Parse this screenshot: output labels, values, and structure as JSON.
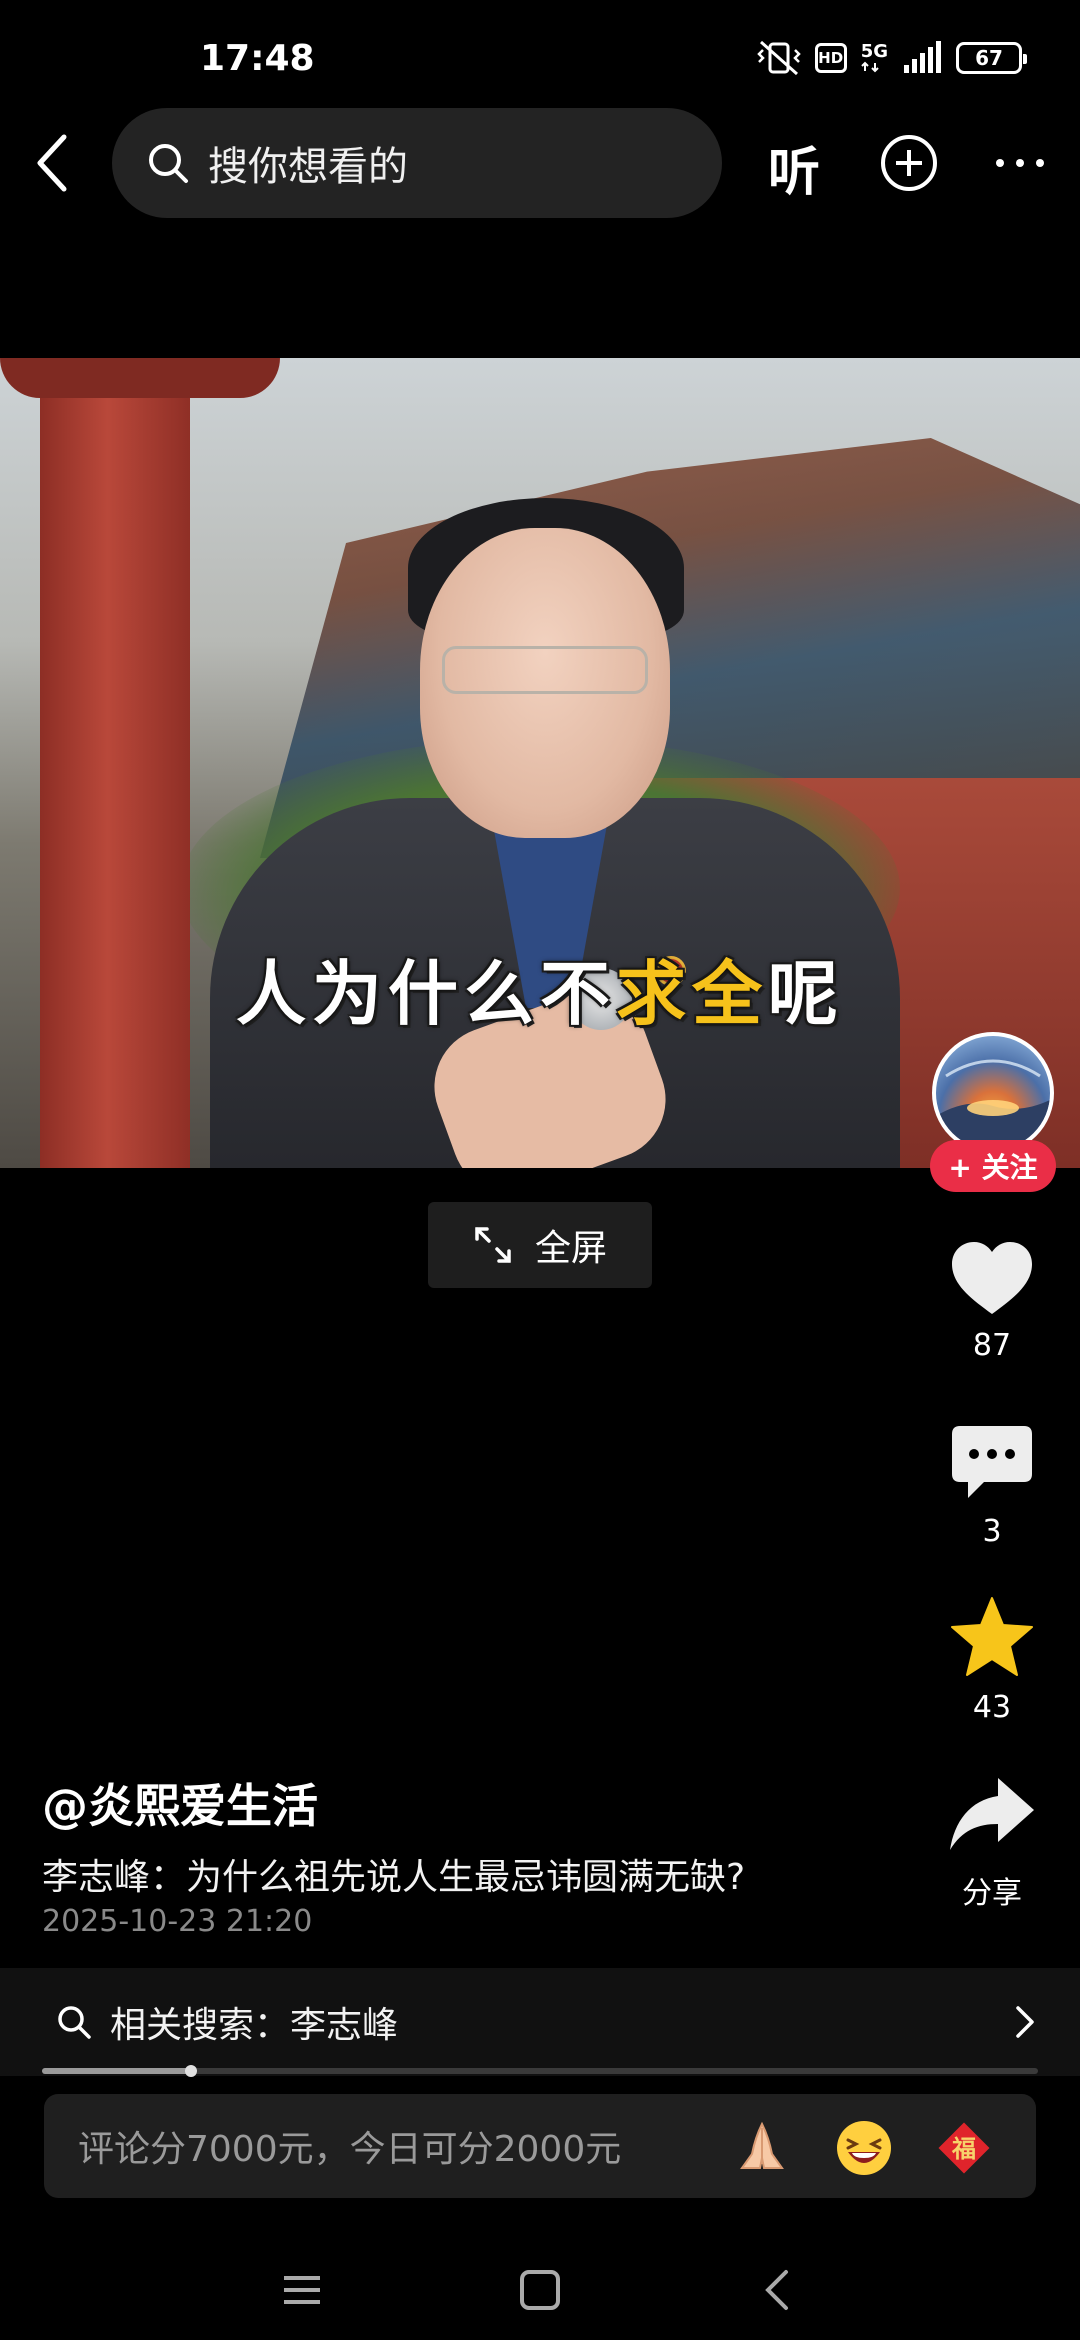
{
  "status_bar": {
    "time": "17:48",
    "hd": "HD",
    "network": "5G",
    "battery": "67"
  },
  "top_nav": {
    "search_placeholder": "搜你想看的",
    "listen_label": "听"
  },
  "video": {
    "subtitle_pre": "人为什么不",
    "subtitle_hl": "求全",
    "subtitle_post": "呢",
    "highlight_color": "#f6c21b"
  },
  "fullscreen": {
    "label": "全屏"
  },
  "rail": {
    "follow_label": "+ 关注",
    "likes": "87",
    "comments": "3",
    "favorites": "43",
    "share_label": "分享",
    "follow_color": "#ea2e47",
    "star_color": "#f7c51a"
  },
  "post": {
    "author": "@炎熙爱生活",
    "caption": "李志峰：为什么祖先说人生最忌讳圆满无缺?",
    "datetime": "2025-10-23 21:20"
  },
  "related_search": {
    "label": "相关搜索：李志峰"
  },
  "progress": {
    "fraction": 0.15
  },
  "comment_bar": {
    "placeholder": "评论分7000元，今日可分2000元",
    "emojis": [
      "praying-hands-icon",
      "laughing-face-icon",
      "fu-sticker-icon"
    ],
    "fu_text": "福"
  },
  "icons": {
    "back": "chevron-left-icon",
    "search": "search-icon",
    "add": "plus-circle-icon",
    "more": "more-horizontal-icon"
  }
}
